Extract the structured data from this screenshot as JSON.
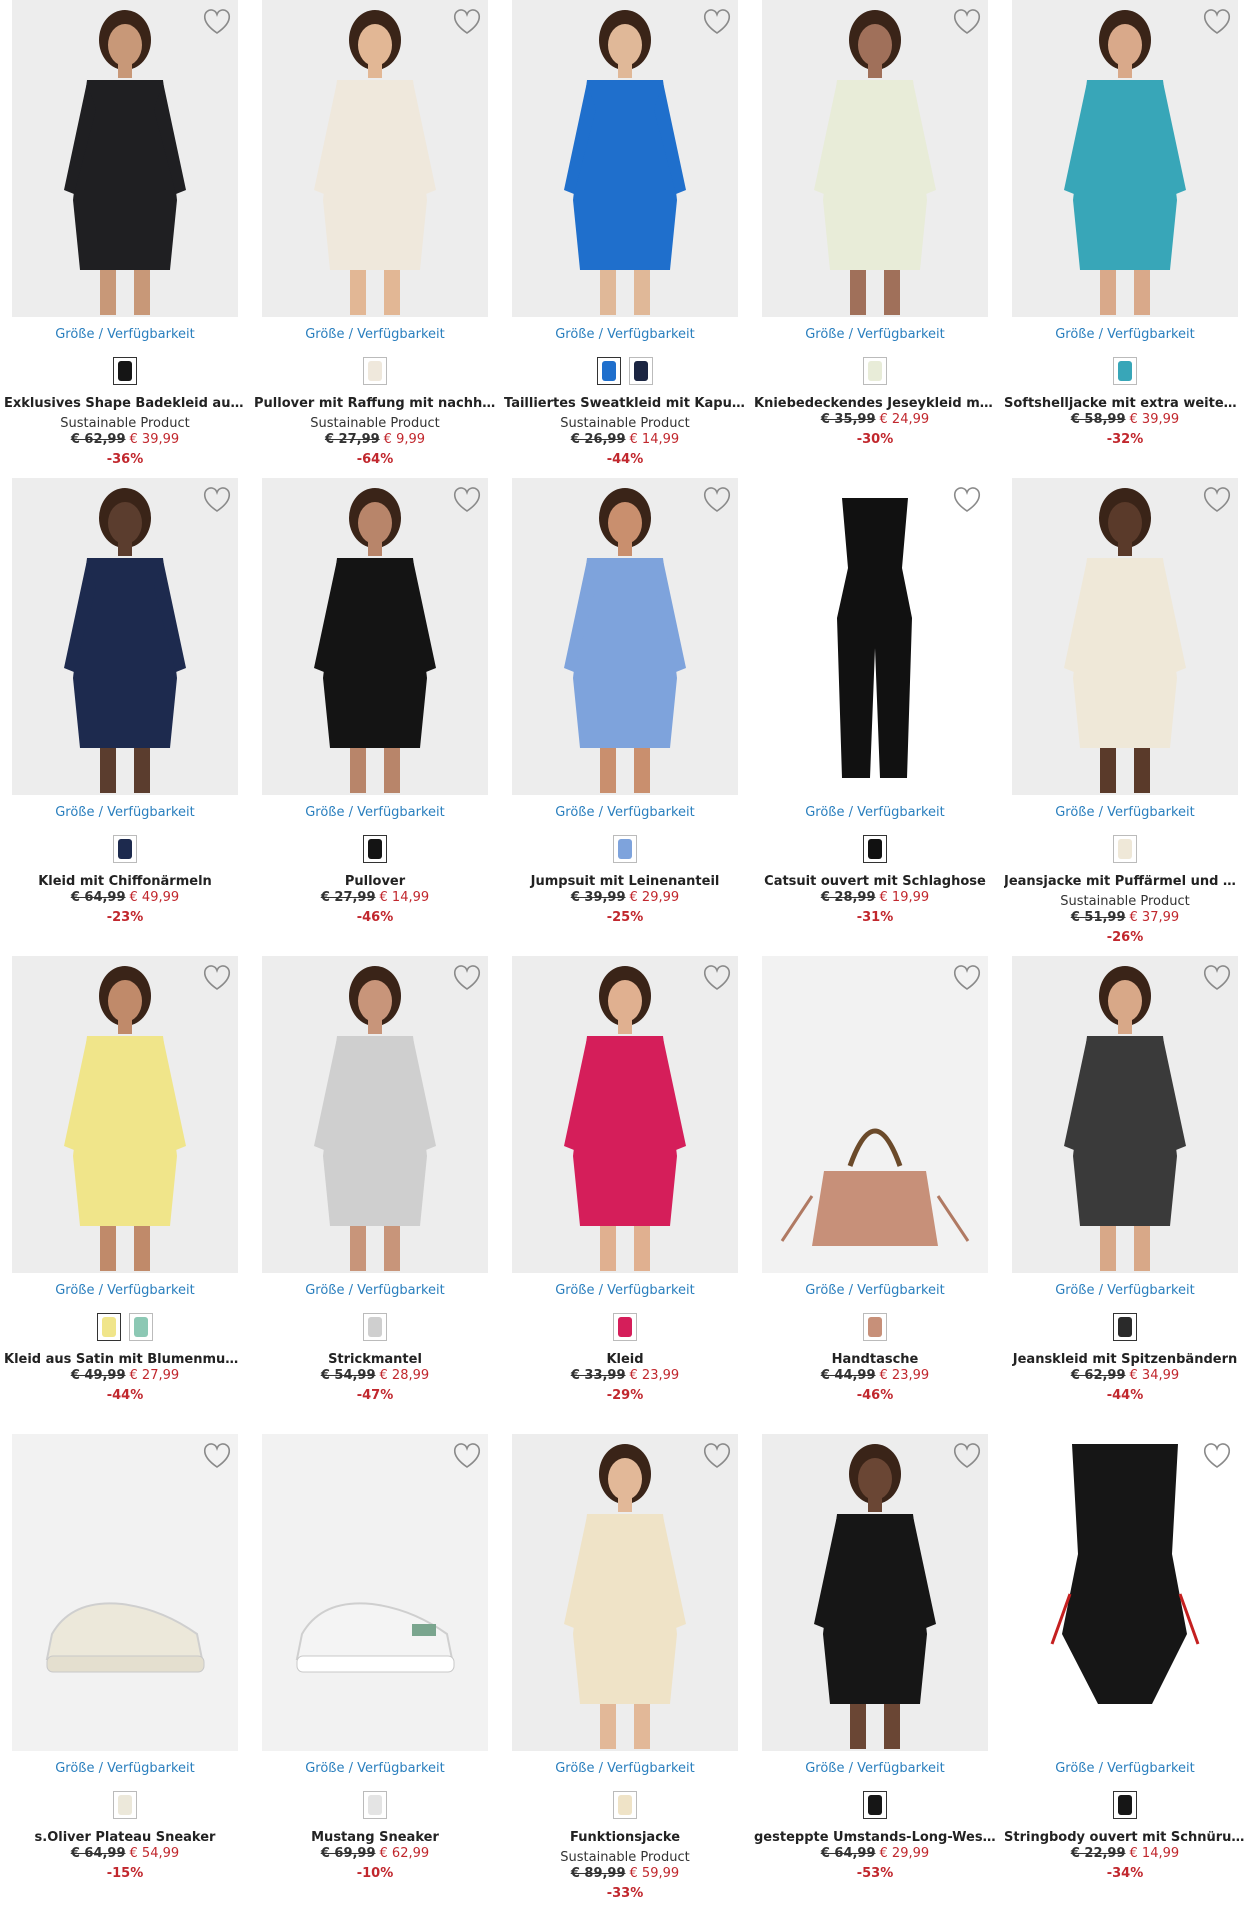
{
  "availability_label": "Größe / Verfügbarkeit",
  "products": [
    {
      "title": "Exklusives Shape Badekleid aus rec...",
      "sub": "Sustainable Product",
      "old": "€ 62,99",
      "new": "€ 39,99",
      "disc": "-36%",
      "bg": "#ededed",
      "garment": "#1f1f22",
      "skin": "#c89878",
      "swatches": [
        {
          "c": "#151515",
          "sel": true
        }
      ]
    },
    {
      "title": "Pullover mit Raffung mit nachhalti...",
      "sub": "Sustainable Product",
      "old": "€ 27,99",
      "new": "€ 9,99",
      "disc": "-64%",
      "bg": "#ededed",
      "garment": "#efe8dc",
      "skin": "#e2b795",
      "swatches": [
        {
          "c": "#efe8dc",
          "sel": false
        }
      ]
    },
    {
      "title": "Tailliertes Sweatkleid mit Kapuze",
      "sub": "Sustainable Product",
      "old": "€ 26,99",
      "new": "€ 14,99",
      "disc": "-44%",
      "bg": "#ededed",
      "garment": "#1f6fcc",
      "skin": "#e0b898",
      "swatches": [
        {
          "c": "#1f6fcc",
          "sel": true
        },
        {
          "c": "#1b2542",
          "sel": false
        }
      ]
    },
    {
      "title": "Kniebedeckendes Jeseykleid mit se...",
      "sub": "",
      "old": "€ 35,99",
      "new": "€ 24,99",
      "disc": "-30%",
      "bg": "#ededed",
      "garment": "#e8ecd8",
      "skin": "#a0705a",
      "swatches": [
        {
          "c": "#e8ecd8",
          "sel": false
        }
      ]
    },
    {
      "title": "Softshelljacke mit extra weitem Är...",
      "sub": "",
      "old": "€ 58,99",
      "new": "€ 39,99",
      "disc": "-32%",
      "bg": "#ededed",
      "garment": "#38a6b8",
      "skin": "#d9a98a",
      "swatches": [
        {
          "c": "#38a6b8",
          "sel": false
        }
      ]
    },
    {
      "title": "Kleid mit Chiffonärmeln",
      "sub": "",
      "old": "€ 64,99",
      "new": "€ 49,99",
      "disc": "-23%",
      "bg": "#ededed",
      "garment": "#1d2a4e",
      "skin": "#5b3d2e",
      "swatches": [
        {
          "c": "#1d2a4e",
          "sel": false
        }
      ]
    },
    {
      "title": "Pullover",
      "sub": "",
      "old": "€ 27,99",
      "new": "€ 14,99",
      "disc": "-46%",
      "bg": "#ededed",
      "garment": "#141414",
      "skin": "#b8856a",
      "swatches": [
        {
          "c": "#141414",
          "sel": true
        }
      ]
    },
    {
      "title": "Jumpsuit mit Leinenanteil",
      "sub": "",
      "old": "€ 39,99",
      "new": "€ 29,99",
      "disc": "-25%",
      "bg": "#ededed",
      "garment": "#7ea3dc",
      "skin": "#c98f6e",
      "swatches": [
        {
          "c": "#7ea3dc",
          "sel": false
        }
      ]
    },
    {
      "title": "Catsuit ouvert mit Schlaghose",
      "sub": "",
      "old": "€ 28,99",
      "new": "€ 19,99",
      "disc": "-31%",
      "bg": "#ffffff",
      "garment": "#111111",
      "skin": "#ffffff",
      "swatches": [
        {
          "c": "#111111",
          "sel": true
        }
      ]
    },
    {
      "title": "Jeansjacke mit Puffärmel und Gürtel",
      "sub": "Sustainable Product",
      "old": "€ 51,99",
      "new": "€ 37,99",
      "disc": "-26%",
      "bg": "#ededed",
      "garment": "#efe8d8",
      "skin": "#5a3a2a",
      "swatches": [
        {
          "c": "#efe8d8",
          "sel": false
        }
      ]
    },
    {
      "title": "Kleid aus Satin mit Blumenmuster",
      "sub": "",
      "old": "€ 49,99",
      "new": "€ 27,99",
      "disc": "-44%",
      "bg": "#ededed",
      "garment": "#f0e58a",
      "skin": "#c08a6a",
      "swatches": [
        {
          "c": "#f0e58a",
          "sel": true
        },
        {
          "c": "#8cc8b4",
          "sel": false
        }
      ]
    },
    {
      "title": "Strickmantel",
      "sub": "",
      "old": "€ 54,99",
      "new": "€ 28,99",
      "disc": "-47%",
      "bg": "#ededed",
      "garment": "#cfcfcf",
      "skin": "#c8957a",
      "swatches": [
        {
          "c": "#cfcfcf",
          "sel": false
        }
      ]
    },
    {
      "title": "Kleid",
      "sub": "",
      "old": "€ 33,99",
      "new": "€ 23,99",
      "disc": "-29%",
      "bg": "#ededed",
      "garment": "#d51e5a",
      "skin": "#e0b090",
      "swatches": [
        {
          "c": "#d51e5a",
          "sel": false
        }
      ]
    },
    {
      "title": "Handtasche",
      "sub": "",
      "old": "€ 44,99",
      "new": "€ 23,99",
      "disc": "-46%",
      "bg": "#f2f2f2",
      "garment": "#c79079",
      "skin": "#f2f2f2",
      "swatches": [
        {
          "c": "#c79079",
          "sel": false
        }
      ]
    },
    {
      "title": "Jeanskleid mit Spitzenbändern",
      "sub": "",
      "old": "€ 62,99",
      "new": "€ 34,99",
      "disc": "-44%",
      "bg": "#ededed",
      "garment": "#3a3a3a",
      "skin": "#d8a888",
      "swatches": [
        {
          "c": "#2a2a2a",
          "sel": true
        }
      ]
    },
    {
      "title": "s.Oliver Plateau Sneaker",
      "sub": "",
      "old": "€ 64,99",
      "new": "€ 54,99",
      "disc": "-15%",
      "bg": "#f2f2f2",
      "garment": "#ece8da",
      "skin": "#f2f2f2",
      "swatches": [
        {
          "c": "#ece8da",
          "sel": false
        }
      ]
    },
    {
      "title": "Mustang Sneaker",
      "sub": "",
      "old": "€ 69,99",
      "new": "€ 62,99",
      "disc": "-10%",
      "bg": "#f2f2f2",
      "garment": "#f4f4f4",
      "skin": "#f2f2f2",
      "swatches": [
        {
          "c": "#e4e4e4",
          "sel": false
        }
      ]
    },
    {
      "title": "Funktionsjacke",
      "sub": "Sustainable Product",
      "old": "€ 89,99",
      "new": "€ 59,99",
      "disc": "-33%",
      "bg": "#ededed",
      "garment": "#efe3c7",
      "skin": "#e2b898",
      "swatches": [
        {
          "c": "#efe3c7",
          "sel": false
        }
      ]
    },
    {
      "title": "gesteppte Umstands-Long-Weste / ...",
      "sub": "",
      "old": "€ 64,99",
      "new": "€ 29,99",
      "disc": "-53%",
      "bg": "#ededed",
      "garment": "#161616",
      "skin": "#6a4634",
      "swatches": [
        {
          "c": "#161616",
          "sel": true
        }
      ]
    },
    {
      "title": "Stringbody ouvert mit Schnürung",
      "sub": "",
      "old": "€ 22,99",
      "new": "€ 14,99",
      "disc": "-34%",
      "bg": "#ffffff",
      "garment": "#161616",
      "skin": "#ffffff",
      "swatches": [
        {
          "c": "#161616",
          "sel": true
        }
      ]
    }
  ]
}
